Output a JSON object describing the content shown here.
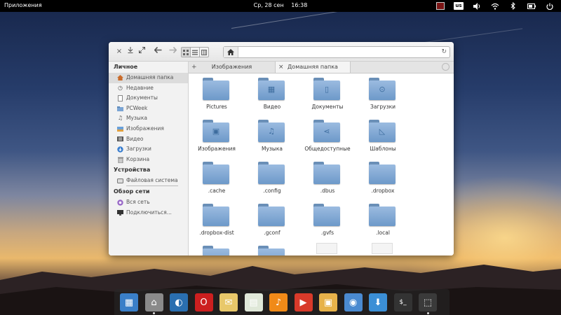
{
  "panel": {
    "applications": "Приложения",
    "date": "Ср, 28 сен",
    "time": "16:38",
    "keyboard_layout": "us"
  },
  "toolbar": {
    "path_home_icon": "home-icon"
  },
  "sidebar": {
    "personal": {
      "title": "Личное",
      "items": [
        {
          "label": "Домашняя папка",
          "icon": "home-icon"
        },
        {
          "label": "Недавние",
          "icon": "recent-icon"
        },
        {
          "label": "Документы",
          "icon": "document-icon"
        },
        {
          "label": "PCWeek",
          "icon": "folder-icon"
        },
        {
          "label": "Музыка",
          "icon": "music-icon"
        },
        {
          "label": "Изображения",
          "icon": "image-icon"
        },
        {
          "label": "Видео",
          "icon": "video-icon"
        },
        {
          "label": "Загрузки",
          "icon": "download-icon"
        },
        {
          "label": "Корзина",
          "icon": "trash-icon"
        }
      ]
    },
    "devices": {
      "title": "Устройства",
      "items": [
        {
          "label": "Файловая система",
          "icon": "drive-icon"
        }
      ]
    },
    "network": {
      "title": "Обзор сети",
      "items": [
        {
          "label": "Вся сеть",
          "icon": "network-icon"
        },
        {
          "label": "Подключиться...",
          "icon": "monitor-icon"
        }
      ]
    }
  },
  "tabs": [
    {
      "label": "Изображения",
      "close": "+"
    },
    {
      "label": "Домашняя папка",
      "close": "×"
    }
  ],
  "files": [
    {
      "name": "Pictures",
      "icon": "folder-icon"
    },
    {
      "name": "Видео",
      "icon": "video-folder-icon"
    },
    {
      "name": "Документы",
      "icon": "document-folder-icon"
    },
    {
      "name": "Загрузки",
      "icon": "download-folder-icon"
    },
    {
      "name": "Изображения",
      "icon": "image-folder-icon"
    },
    {
      "name": "Музыка",
      "icon": "music-folder-icon"
    },
    {
      "name": "Общедоступные",
      "icon": "share-folder-icon"
    },
    {
      "name": "Шаблоны",
      "icon": "template-folder-icon"
    },
    {
      "name": ".cache",
      "icon": "folder-icon"
    },
    {
      "name": ".config",
      "icon": "folder-icon"
    },
    {
      "name": ".dbus",
      "icon": "folder-icon"
    },
    {
      "name": ".dropbox",
      "icon": "folder-icon"
    },
    {
      "name": ".dropbox-dist",
      "icon": "folder-icon"
    },
    {
      "name": ".gconf",
      "icon": "folder-icon"
    },
    {
      "name": ".gvfs",
      "icon": "folder-icon"
    },
    {
      "name": ".local",
      "icon": "folder-icon"
    }
  ],
  "dock": [
    {
      "name": "multitasking-view",
      "color": "#3a7fc8"
    },
    {
      "name": "files",
      "color": "#8a8a8a"
    },
    {
      "name": "web-browser",
      "color": "#2a6fb0"
    },
    {
      "name": "opera",
      "color": "#cc1f1f"
    },
    {
      "name": "mail",
      "color": "#e8c86a"
    },
    {
      "name": "calendar",
      "color": "#dfe8d8"
    },
    {
      "name": "music",
      "color": "#f08a18"
    },
    {
      "name": "videos",
      "color": "#d83a2a"
    },
    {
      "name": "photos",
      "color": "#e7b24a"
    },
    {
      "name": "settings",
      "color": "#4a8ad0"
    },
    {
      "name": "app-center",
      "color": "#3b8fd6"
    },
    {
      "name": "terminal",
      "color": "#333333"
    },
    {
      "name": "screenshot",
      "color": "#3a3a3a"
    }
  ]
}
